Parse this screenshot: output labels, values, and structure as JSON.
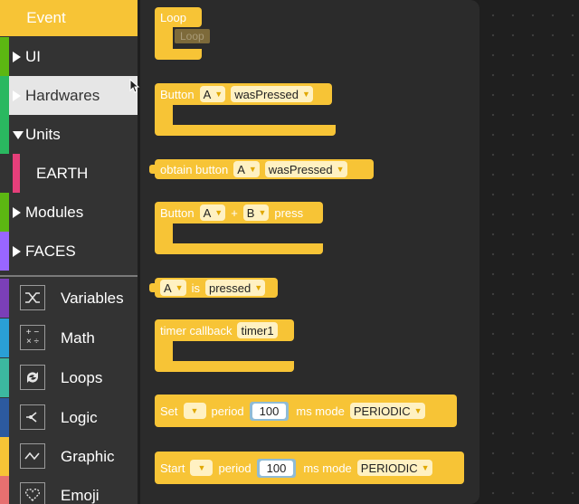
{
  "sidebar": {
    "categories": [
      {
        "label": "Event",
        "color": "#f7c436"
      },
      {
        "label": "UI",
        "color": "#5cb712"
      },
      {
        "label": "Hardwares",
        "color": "#2ab860"
      },
      {
        "label": "Units",
        "color": "#2ab860"
      },
      {
        "label": "EARTH",
        "color": "#e63f7a"
      },
      {
        "label": "Modules",
        "color": "#5cb712"
      },
      {
        "label": "FACES",
        "color": "#9966ff"
      }
    ],
    "tools": [
      {
        "label": "Variables",
        "color": "#7b3fb8",
        "icon": "variables-icon"
      },
      {
        "label": "Math",
        "color": "#2a9fd6",
        "icon": "math-icon"
      },
      {
        "label": "Loops",
        "color": "#3cb8a0",
        "icon": "loops-icon"
      },
      {
        "label": "Logic",
        "color": "#2c5aa0",
        "icon": "logic-icon"
      },
      {
        "label": "Graphic",
        "color": "#f7c436",
        "icon": "graphic-icon"
      },
      {
        "label": "Emoji",
        "color": "#e67070",
        "icon": "emoji-icon"
      }
    ]
  },
  "flyout": {
    "loop": {
      "label": "Loop",
      "ghost": "Loop"
    },
    "button_pressed": {
      "label": "Button",
      "button": "A",
      "event": "wasPressed"
    },
    "obtain_button": {
      "label": "obtain button",
      "button": "A",
      "event": "wasPressed"
    },
    "button_combo": {
      "label": "Button",
      "button1": "A",
      "plus": "+",
      "button2": "B",
      "tail": "press"
    },
    "is_pressed": {
      "button": "A",
      "mid": "is",
      "state": "pressed"
    },
    "timer_callback": {
      "label": "timer callback",
      "timer": "timer1"
    },
    "set_period": {
      "label": "Set",
      "dropdown": "",
      "period_label": "period",
      "value": "100",
      "mode_label": "ms mode",
      "mode": "PERIODIC"
    },
    "start_period": {
      "label": "Start",
      "dropdown": "",
      "period_label": "period",
      "value": "100",
      "mode_label": "ms mode",
      "mode": "PERIODIC"
    }
  },
  "colors": {
    "block": "#f7c436",
    "sidebar": "#333333",
    "flyout": "#2b2b2b",
    "workspace": "#1f1f1f"
  }
}
